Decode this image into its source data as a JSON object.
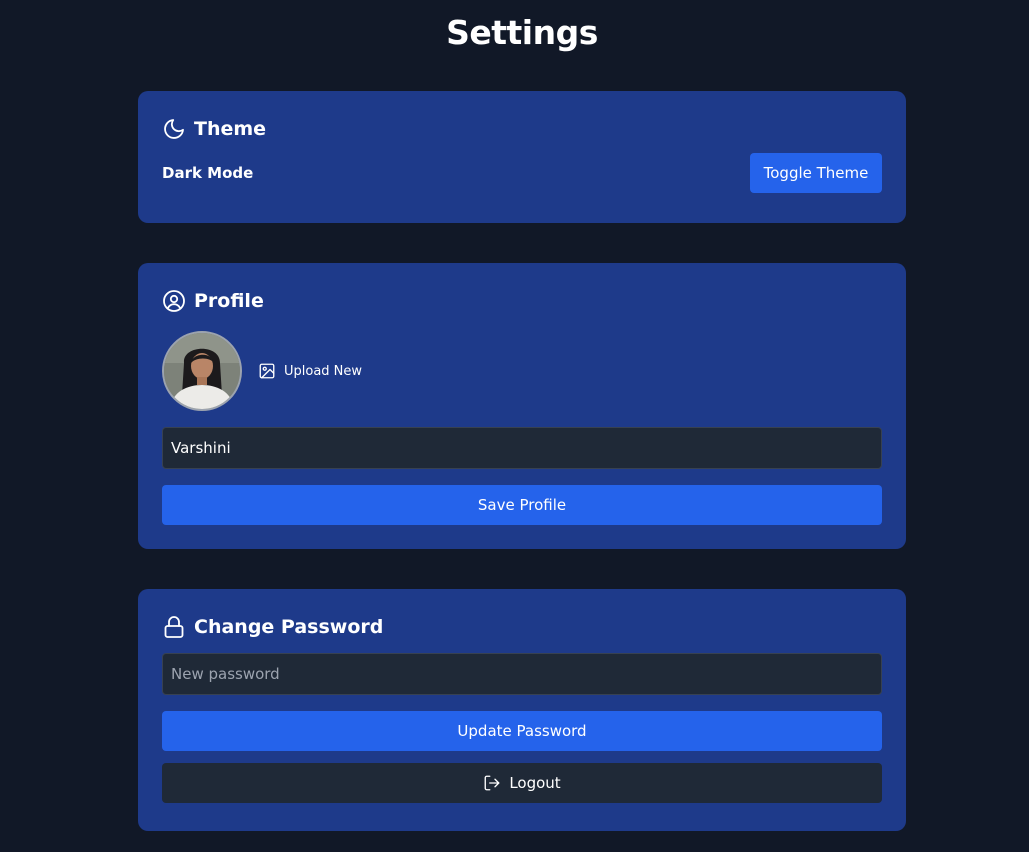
{
  "page": {
    "title": "Settings"
  },
  "theme": {
    "title": "Theme",
    "icon": "moon-icon",
    "row_label": "Dark Mode",
    "toggle_label": "Toggle Theme"
  },
  "profile": {
    "title": "Profile",
    "icon": "user-circle-icon",
    "upload_icon": "image-icon",
    "upload_label": "Upload New",
    "name_value": "Varshini",
    "save_label": "Save Profile"
  },
  "password": {
    "title": "Change Password",
    "icon": "lock-icon",
    "input_placeholder": "New password",
    "update_label": "Update Password",
    "logout_icon": "logout-icon",
    "logout_label": "Logout"
  },
  "colors": {
    "page_bg": "#111827",
    "card_bg": "#1e3a8a",
    "primary": "#2563eb",
    "input_bg": "#1f2937"
  }
}
